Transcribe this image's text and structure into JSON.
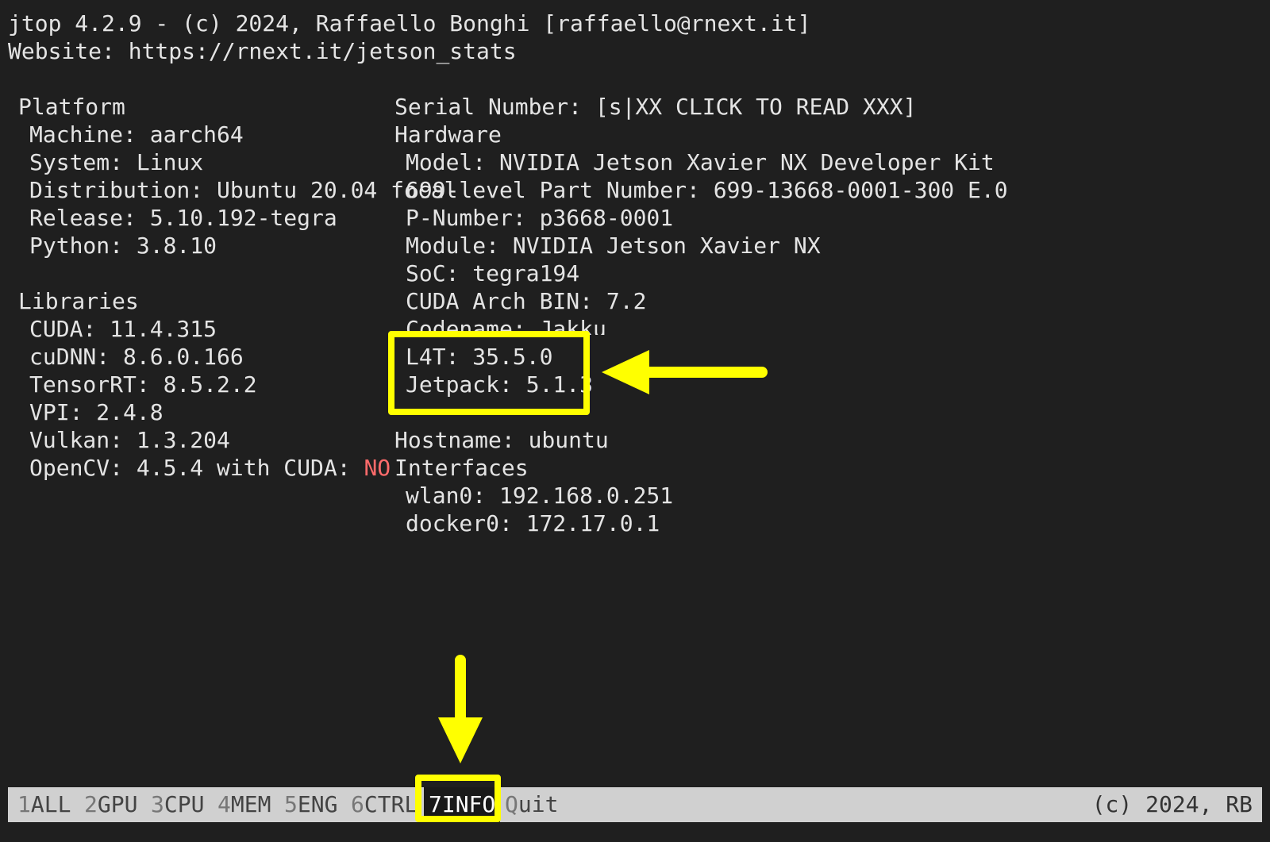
{
  "header": {
    "title": "jtop 4.2.9 - (c) 2024, Raffaello Bonghi [raffaello@rnext.it]",
    "website": "Website: https://rnext.it/jetson_stats"
  },
  "platform": {
    "heading": "Platform",
    "machine": "Machine: aarch64",
    "system": "System: Linux",
    "distribution": "Distribution: Ubuntu 20.04 focal",
    "release": "Release: 5.10.192-tegra",
    "python": "Python: 3.8.10"
  },
  "libraries": {
    "heading": "Libraries",
    "cuda": "CUDA: 11.4.315",
    "cudnn": "cuDNN: 8.6.0.166",
    "tensorrt": "TensorRT: 8.5.2.2",
    "vpi": "VPI: 2.4.8",
    "vulkan": "Vulkan: 1.3.204",
    "opencv_label": "OpenCV: 4.5.4 with CUDA: ",
    "opencv_cuda": "NO"
  },
  "right": {
    "serial": "Serial Number: [s|XX CLICK TO READ XXX]",
    "hardware_heading": "Hardware",
    "model": "Model: NVIDIA Jetson Xavier NX Developer Kit",
    "part_number": "699-level Part Number: 699-13668-0001-300 E.0",
    "p_number": "P-Number: p3668-0001",
    "module": "Module: NVIDIA Jetson Xavier NX",
    "soc": "SoC: tegra194",
    "cuda_arch": "CUDA Arch BIN: 7.2",
    "codename": "Codename: Jakku",
    "l4t": "L4T: 35.5.0",
    "jetpack": "Jetpack: 5.1.3",
    "hostname": "Hostname: ubuntu",
    "interfaces_heading": "Interfaces",
    "wlan0": "wlan0: 192.168.0.251",
    "docker0": "docker0: 172.17.0.1"
  },
  "menu": {
    "items": [
      {
        "num": "1",
        "label": "ALL"
      },
      {
        "num": "2",
        "label": "GPU"
      },
      {
        "num": "3",
        "label": "CPU"
      },
      {
        "num": "4",
        "label": "MEM"
      },
      {
        "num": "5",
        "label": "ENG"
      },
      {
        "num": "6",
        "label": "CTRL"
      },
      {
        "num": "7",
        "label": "INFO"
      },
      {
        "num": "Q",
        "label": "uit"
      }
    ],
    "copyright": "(c) 2024, RB"
  },
  "colors": {
    "background": "#1f1f1f",
    "text": "#e4e4e4",
    "highlight": "#ffff00",
    "warning": "#ff6b6b"
  }
}
